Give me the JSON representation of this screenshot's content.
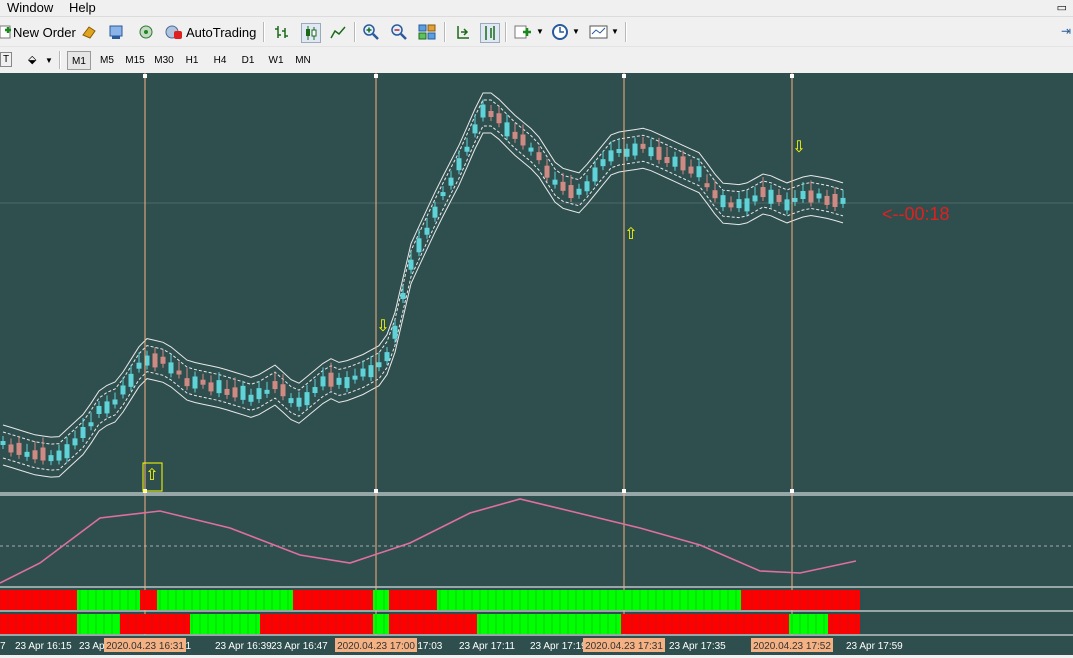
{
  "menu": {
    "window": "Window",
    "help": "Help"
  },
  "toolbar": {
    "new_order": "New Order",
    "autotrading": "AutoTrading",
    "left_cut": "T"
  },
  "timeframes": {
    "items": [
      "M1",
      "M5",
      "M15",
      "M30",
      "H1",
      "H4",
      "D1",
      "W1",
      "MN"
    ],
    "active": "M1"
  },
  "chart": {
    "timer": "<--00:18",
    "colors": {
      "background": "#2f4f4f",
      "bull": "#5fd3d8",
      "bear": "#d08a84",
      "indicator": "#e06fa0",
      "arrow": "#ffff00",
      "vline": "#f4b183",
      "bar_green": "#00ff00",
      "bar_red": "#ff0000"
    },
    "time_labels": [
      "7",
      "23 Apr 16:15",
      "23 Apr 16:",
      "31",
      "23 Apr 16:39",
      "23 Apr 16:47",
      "Apr 17:03",
      "23 Apr 17:11",
      "23 Apr 17:19",
      "23 Apr 17:35",
      "23 Apr 17:59"
    ],
    "vline_labels": [
      "2020.04.23 16:31",
      "2020.04.23 17:00",
      "2020.04.23 17:31",
      "2020.04.23 17:52"
    ],
    "arrows": {
      "up": "⇧",
      "down": "⇩"
    }
  }
}
